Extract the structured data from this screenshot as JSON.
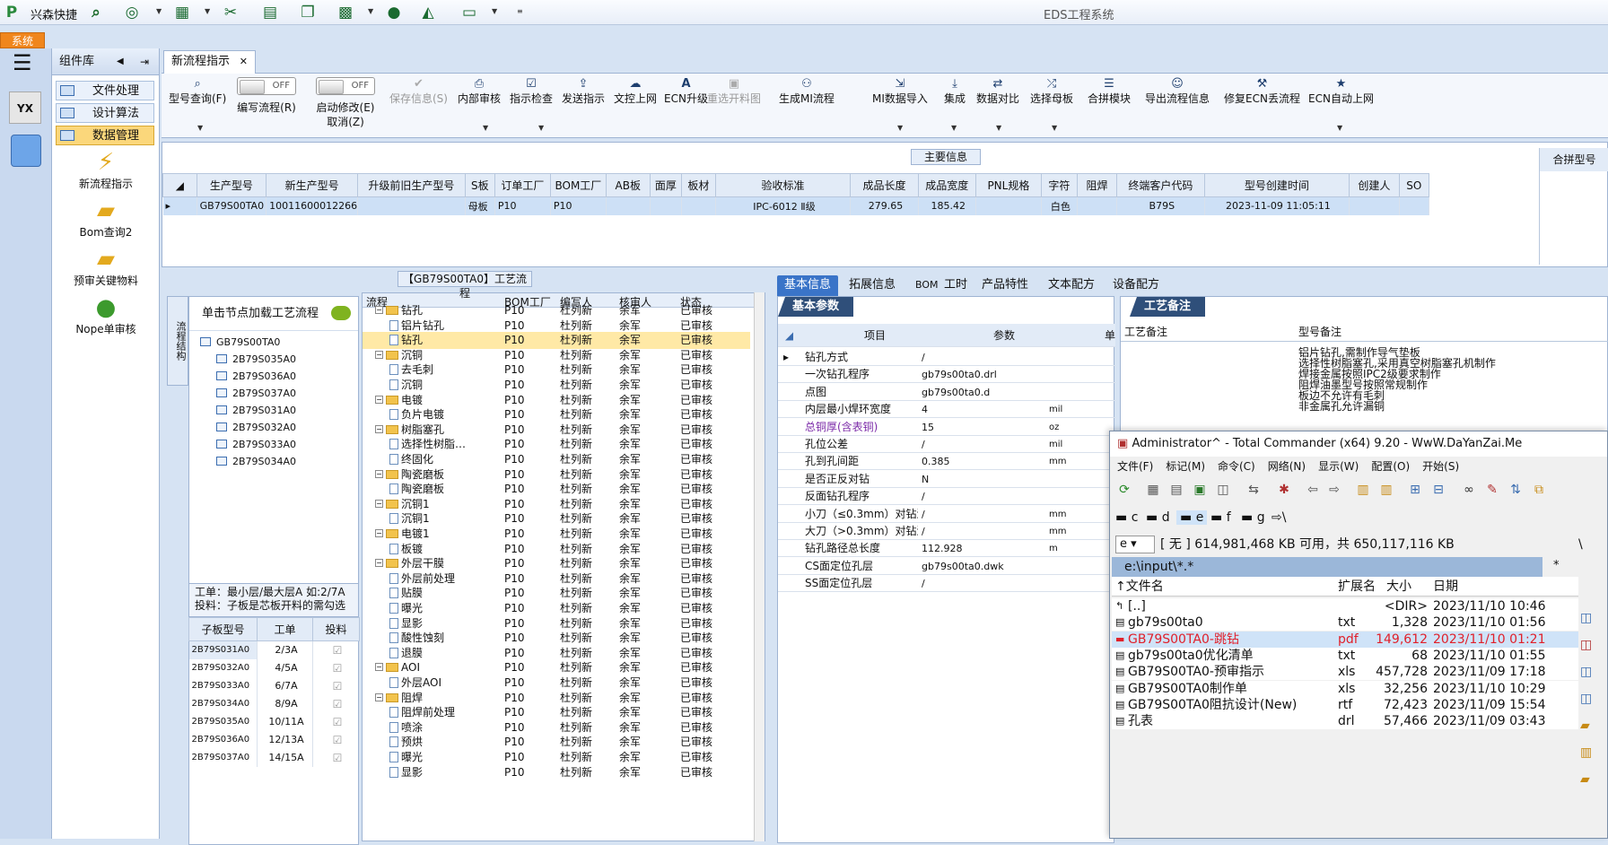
{
  "app": {
    "title": "EDS工程系统",
    "quick_label": "兴森快捷",
    "system_tab": "系统"
  },
  "sidebar": {
    "title": "组件库",
    "items": [
      {
        "label": "文件处理"
      },
      {
        "label": "设计算法"
      },
      {
        "label": "数据管理"
      }
    ],
    "tools": [
      {
        "label": "新流程指示"
      },
      {
        "label": "Bom查询2"
      },
      {
        "label": "预审关键物料"
      },
      {
        "label": "Nope单审核"
      }
    ]
  },
  "tab": {
    "label": "新流程指示"
  },
  "ribbon": [
    {
      "label": "型号查询(F)",
      "icon": "search"
    },
    {
      "label": "编写流程(R)",
      "toggle": "OFF"
    },
    {
      "label": "启动修改(E)",
      "sub": "取消(Z)",
      "toggle": "OFF"
    },
    {
      "label": "保存信息(S)",
      "icon": "check",
      "disabled": true
    },
    {
      "label": "内部审核",
      "icon": "print"
    },
    {
      "label": "指示检查",
      "icon": "check"
    },
    {
      "label": "发送指示",
      "icon": "upload"
    },
    {
      "label": "文控上网",
      "icon": "cloud"
    },
    {
      "label": "ECN升级",
      "icon": "A"
    },
    {
      "label": "重选开料图",
      "icon": "image",
      "disabled": true
    },
    {
      "label": "生成MI流程",
      "icon": "tree"
    },
    {
      "label": "MI数据导入",
      "icon": "import"
    },
    {
      "label": "集成",
      "icon": "download"
    },
    {
      "label": "数据对比",
      "icon": "compare"
    },
    {
      "label": "选择母板",
      "icon": "shuffle"
    },
    {
      "label": "合拼模块",
      "icon": "list"
    },
    {
      "label": "导出流程信息",
      "icon": "smile"
    },
    {
      "label": "修复ECN丢流程",
      "icon": "wrench"
    },
    {
      "label": "ECN自动上网",
      "icon": "star"
    }
  ],
  "main_info": {
    "title": "主要信息",
    "columns": [
      "生产型号",
      "新生产型号",
      "升级前旧生产型号",
      "S板",
      "订单工厂",
      "BOM工厂",
      "AB板",
      "面厚",
      "板材",
      "验收标准",
      "成品长度",
      "成品宽度",
      "PNL规格",
      "字符",
      "阻焊",
      "终端客户代码",
      "型号创建时间",
      "创建人",
      "SO"
    ],
    "row": [
      "GB79S00TA0",
      "10011600012266",
      "",
      "母板",
      "P10",
      "P10",
      "",
      "",
      "",
      "IPC-6012 Ⅱ级",
      "279.65",
      "185.42",
      "",
      "白色",
      "",
      "B79S",
      "2023-11-09 11:05:11",
      "",
      ""
    ],
    "right_col": "合拼型号"
  },
  "process": {
    "title": "【GB79S00TA0】工艺流程",
    "hint": "单击节点加载工艺流程",
    "side_tab": "流程结构",
    "tree_root": "GB79S00TA0",
    "tree_children": [
      "2B79S035A0",
      "2B79S036A0",
      "2B79S037A0",
      "2B79S031A0",
      "2B79S032A0",
      "2B79S033A0",
      "2B79S034A0"
    ],
    "info": [
      "工单：最小层/最大层A 如:2/7A",
      "投料：子板是芯板开料的需勾选"
    ],
    "sub_columns": [
      "子板型号",
      "工单",
      "投料"
    ],
    "sub_rows": [
      [
        "2B79S031A0",
        "2/3A"
      ],
      [
        "2B79S032A0",
        "4/5A"
      ],
      [
        "2B79S033A0",
        "6/7A"
      ],
      [
        "2B79S034A0",
        "8/9A"
      ],
      [
        "2B79S035A0",
        "10/11A"
      ],
      [
        "2B79S036A0",
        "12/13A"
      ],
      [
        "2B79S037A0",
        "14/15A"
      ]
    ],
    "flow_columns": [
      "流程",
      "BOM工厂",
      "编写人",
      "核审人",
      "状态"
    ],
    "flow_rows": [
      {
        "name": "钻孔",
        "type": "folder",
        "level": 1
      },
      {
        "name": "铝片钻孔",
        "type": "file",
        "level": 2
      },
      {
        "name": "钻孔",
        "type": "file",
        "level": 2,
        "sel": true
      },
      {
        "name": "沉铜",
        "type": "folder",
        "level": 1
      },
      {
        "name": "去毛刺",
        "type": "file",
        "level": 2
      },
      {
        "name": "沉铜",
        "type": "file",
        "level": 2
      },
      {
        "name": "电镀",
        "type": "folder",
        "level": 1
      },
      {
        "name": "负片电镀",
        "type": "file",
        "level": 2
      },
      {
        "name": "树脂塞孔",
        "type": "folder",
        "level": 1
      },
      {
        "name": "选择性树脂…",
        "type": "file",
        "level": 2
      },
      {
        "name": "终固化",
        "type": "file",
        "level": 2
      },
      {
        "name": "陶瓷磨板",
        "type": "folder",
        "level": 1
      },
      {
        "name": "陶瓷磨板",
        "type": "file",
        "level": 2
      },
      {
        "name": "沉铜1",
        "type": "folder",
        "level": 1
      },
      {
        "name": "沉铜1",
        "type": "file",
        "level": 2
      },
      {
        "name": "电镀1",
        "type": "folder",
        "level": 1
      },
      {
        "name": "板镀",
        "type": "file",
        "level": 2
      },
      {
        "name": "外层干膜",
        "type": "folder",
        "level": 1
      },
      {
        "name": "外层前处理",
        "type": "file",
        "level": 2
      },
      {
        "name": "贴膜",
        "type": "file",
        "level": 2
      },
      {
        "name": "曝光",
        "type": "file",
        "level": 2
      },
      {
        "name": "显影",
        "type": "file",
        "level": 2
      },
      {
        "name": "酸性蚀刻",
        "type": "file",
        "level": 2
      },
      {
        "name": "退膜",
        "type": "file",
        "level": 2
      },
      {
        "name": "AOI",
        "type": "folder",
        "level": 1
      },
      {
        "name": "外层AOI",
        "type": "file",
        "level": 2
      },
      {
        "name": "阻焊",
        "type": "folder",
        "level": 1
      },
      {
        "name": "阻焊前处理",
        "type": "file",
        "level": 2
      },
      {
        "name": "喷涂",
        "type": "file",
        "level": 2
      },
      {
        "name": "预烘",
        "type": "file",
        "level": 2
      },
      {
        "name": "曝光",
        "type": "file",
        "level": 2
      },
      {
        "name": "显影",
        "type": "file",
        "level": 2
      }
    ],
    "flow_common": {
      "factory": "P10",
      "writer": "杜列新",
      "reviewer": "余军",
      "status": "已审核"
    }
  },
  "right_tabs": [
    "基本信息",
    "拓展信息",
    "BOM",
    "工时",
    "产品特性",
    "文本配方",
    "设备配方"
  ],
  "basic": {
    "title": "基本参数",
    "col_item": "项目",
    "col_param": "参数",
    "col_unit": "单",
    "rows": [
      [
        "钻孔方式",
        "/",
        ""
      ],
      [
        "一次钻孔程序",
        "gb79s00ta0.drl",
        ""
      ],
      [
        "点图",
        "gb79s00ta0.d",
        ""
      ],
      [
        "内层最小焊环宽度",
        "4",
        "mil"
      ],
      [
        "总铜厚(含表铜)",
        "15",
        "oz"
      ],
      [
        "孔位公差",
        "/",
        "mil"
      ],
      [
        "孔到孔间距",
        "0.385",
        "mm"
      ],
      [
        "是否正反对钻",
        "N",
        ""
      ],
      [
        "反面钻孔程序",
        "/",
        ""
      ],
      [
        "小刀（≤0.3mm）对钻深度",
        "/",
        "mm"
      ],
      [
        "大刀（>0.3mm）对钻深度",
        "/",
        "mm"
      ],
      [
        "钻孔路径总长度",
        "112.928",
        "m"
      ],
      [
        "CS面定位孔层",
        "gb79s00ta0.dwk",
        ""
      ],
      [
        "SS面定位孔层",
        "/",
        ""
      ]
    ],
    "highlight_row": 4,
    "highlight_color": "#7b2aa8"
  },
  "notes": {
    "title": "工艺备注",
    "col1": "工艺备注",
    "col2": "型号备注",
    "text": "铝片钻孔,需制作导气垫板\n选择性树脂塞孔,采用真空树脂塞孔机制作\n焊接金属按照IPC2级要求制作\n阻焊油墨型号按照常规制作\n板边不允许有毛刺\n非金属孔允许漏铜"
  },
  "tc": {
    "title": "Administrator^ - Total Commander (x64) 9.20 - WwW.DaYanZai.Me",
    "menu": [
      "文件(F)",
      "标记(M)",
      "命令(C)",
      "网络(N)",
      "显示(W)",
      "配置(O)",
      "开始(S)"
    ],
    "drives": [
      "c",
      "d",
      "e",
      "f",
      "g",
      "\\"
    ],
    "drive_sel": "e",
    "free": "[ 无 ]  614,981,468 KB 可用，共 650,117,116 KB",
    "path": "e:\\input\\*.*",
    "path_filter": "*",
    "cols": [
      "文件名",
      "扩展名",
      "大小",
      "日期"
    ],
    "files": [
      [
        "[..]",
        "",
        "<DIR>",
        "2023/11/10 10:46"
      ],
      [
        "gb79s00ta0",
        "txt",
        "1,328",
        "2023/11/10 01:56"
      ],
      [
        "GB79S00TA0-跳钻",
        "pdf",
        "149,612",
        "2023/11/10 01:21"
      ],
      [
        "gb79s00ta0优化清单",
        "txt",
        "68",
        "2023/11/10 01:55"
      ],
      [
        "GB79S00TA0-预审指示",
        "xls",
        "457,728",
        "2023/11/09 17:18"
      ],
      [
        "GB79S00TA0制作单",
        "xls",
        "32,256",
        "2023/11/10 10:29"
      ],
      [
        "GB79S00TA0阻抗设计(New)",
        "rtf",
        "72,423",
        "2023/11/09 15:54"
      ],
      [
        "孔表",
        "drl",
        "57,466",
        "2023/11/09 03:43"
      ]
    ],
    "sel_index": 2
  }
}
